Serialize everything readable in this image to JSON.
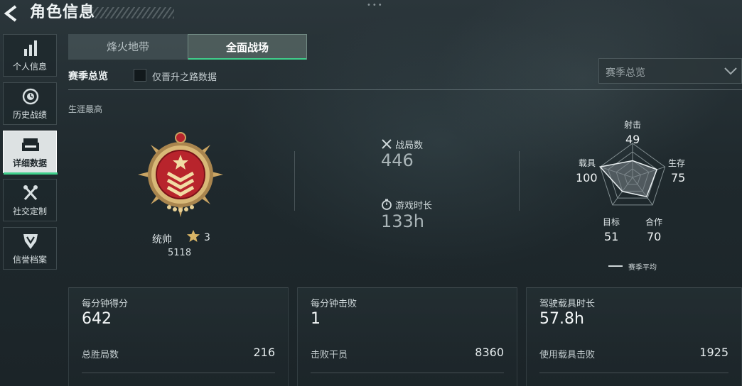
{
  "header": {
    "title": "角色信息",
    "dots": "•••"
  },
  "sidebar": {
    "items": [
      {
        "label": "个人信息",
        "icon": "bar-chart-icon"
      },
      {
        "label": "历史战绩",
        "icon": "history-icon"
      },
      {
        "label": "详细数据",
        "icon": "folder-icon",
        "active": true
      },
      {
        "label": "社交定制",
        "icon": "tools-icon"
      },
      {
        "label": "信誉档案",
        "icon": "shield-badge-icon"
      }
    ]
  },
  "tabs": [
    {
      "label": "烽火地带",
      "active": false
    },
    {
      "label": "全面战场",
      "active": true
    }
  ],
  "filter": {
    "section_label": "赛季总览",
    "checkbox_label": "仅晋升之路数据",
    "checkbox_checked": false,
    "dropdown_value": "赛季总览"
  },
  "career": {
    "label": "生涯最高",
    "rank_name": "统帅",
    "rank_stars": "3",
    "rank_score": "5118"
  },
  "summary": {
    "matches_label": "战局数",
    "matches_value": "446",
    "playtime_label": "游戏时长",
    "playtime_value": "133h"
  },
  "radar": {
    "axes": [
      {
        "label": "射击",
        "value": "49"
      },
      {
        "label": "生存",
        "value": "75"
      },
      {
        "label": "合作",
        "value": "70"
      },
      {
        "label": "目标",
        "value": "51"
      },
      {
        "label": "载具",
        "value": "100"
      }
    ],
    "legend": "赛季平均"
  },
  "cards": [
    {
      "title": "每分钟得分",
      "value": "642",
      "sub_label": "总胜局数",
      "sub_value": "216"
    },
    {
      "title": "每分钟击败",
      "value": "1",
      "sub_label": "击败干员",
      "sub_value": "8360"
    },
    {
      "title": "驾驶载具时长",
      "value": "57.8h",
      "sub_label": "使用载具击败",
      "sub_value": "1925"
    }
  ],
  "colors": {
    "accent": "#3fd08c",
    "medal_gold": "#c9a463",
    "medal_red": "#b8242c"
  }
}
